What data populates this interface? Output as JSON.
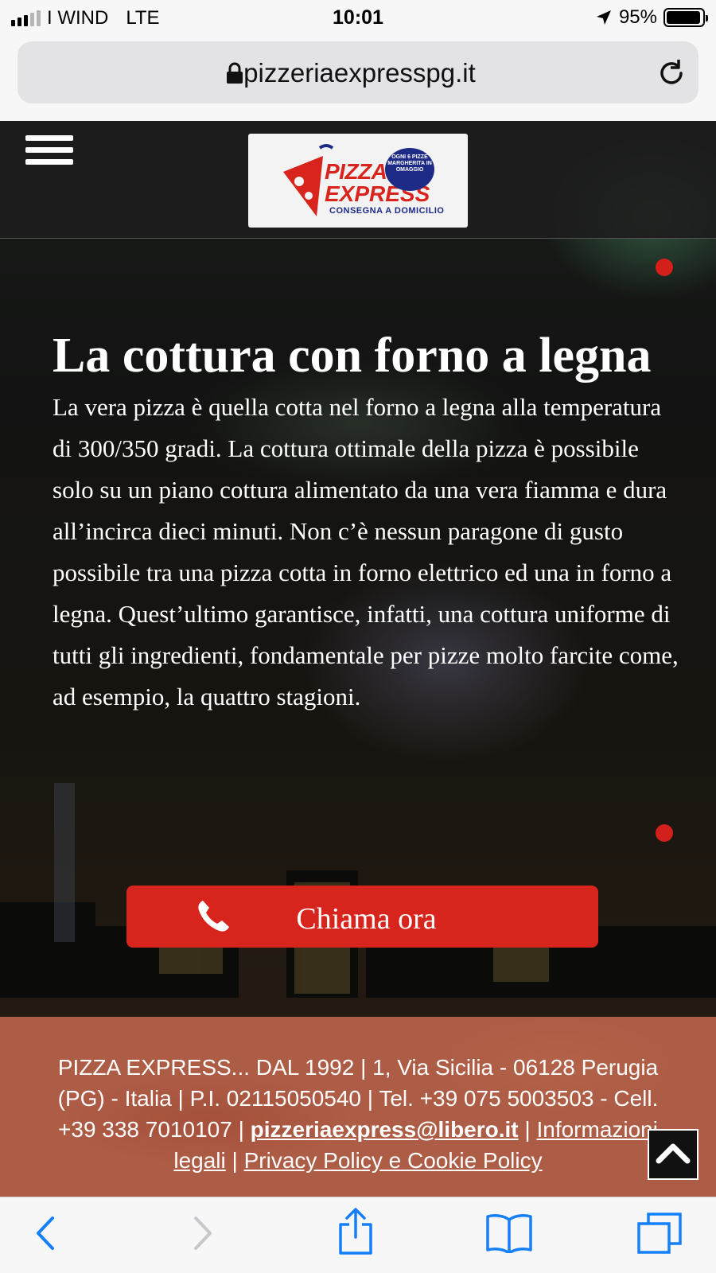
{
  "status_bar": {
    "carrier": "I WIND",
    "network": "LTE",
    "time": "10:01",
    "battery_percent": "95%",
    "battery_level": 0.95,
    "signal_bars": 3,
    "signal_max": 5
  },
  "browser": {
    "url": "pizzeriaexpresspg.it",
    "lock_icon": "lock-icon",
    "reload_icon": "reload-icon"
  },
  "site_header": {
    "menu_icon": "hamburger-menu-icon",
    "logo": {
      "title_line1": "PIZZA",
      "title_line2": "EXPRESS",
      "tagline": "CONSEGNA A DOMICILIO",
      "badge_text": "OGNI 6 PIZZE MARGHERITA IN OMAGGIO"
    }
  },
  "hero": {
    "title": "La cottura con forno a legna",
    "text": "La vera pizza è quella cotta nel forno a legna alla temperatura di 300/350 gradi. La cottura ottimale della pizza è possibile solo su un piano cottura alimentato da una vera fiamma e dura all’incirca dieci minuti. Non c’è nessun paragone di gusto possibile tra una pizza cotta in forno elettrico ed una in forno a legna. Quest’ultimo garantisce, infatti, una cottura uniforme di tutti gli ingredienti, fondamentale per pizze molto farcite come, ad esempio, la quattro stagioni."
  },
  "call_button": {
    "label": "Chiama ora",
    "icon": "phone-icon"
  },
  "footer": {
    "line1": "PIZZA EXPRESS... DAL 1992 | 1, Via Sicilia - 06128 Perugia (PG) - Italia | P.I. 02115050540 | Tel. +39 075 5003503   - Cell. +39 338 7010107 |",
    "email": "pizzeriaexpress@libero.it",
    "sep1": " | ",
    "legal_link": "Informazioni legali",
    "sep2": " |",
    "privacy_link": "Privacy Policy e Cookie Policy"
  },
  "scroll_top_icon": "chevron-up-icon",
  "toolbar": {
    "icons": [
      "back-icon",
      "forward-icon",
      "share-icon",
      "bookmarks-icon",
      "tabs-icon"
    ],
    "accent": "#157efb",
    "disabled": "#c7c7cc"
  },
  "colors": {
    "brand_red": "#d7251d",
    "footer_bg": "#ad5c45",
    "header_bg": "#1c1c1c"
  }
}
